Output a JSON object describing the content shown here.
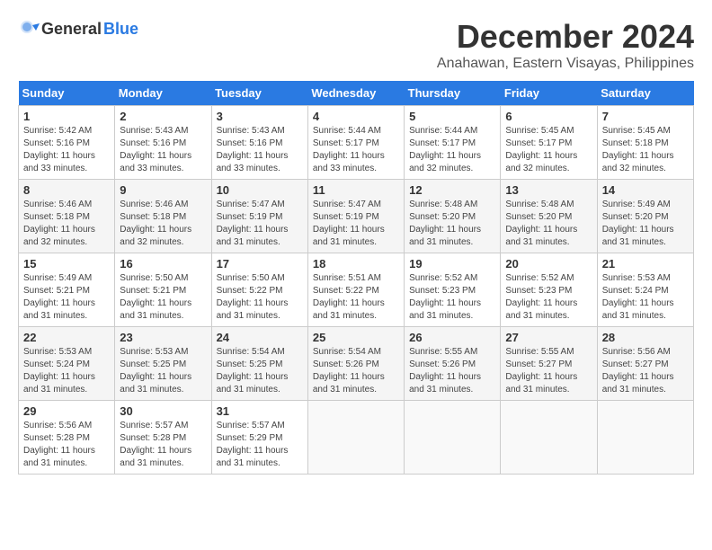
{
  "logo": {
    "general": "General",
    "blue": "Blue"
  },
  "title": "December 2024",
  "location": "Anahawan, Eastern Visayas, Philippines",
  "days_header": [
    "Sunday",
    "Monday",
    "Tuesday",
    "Wednesday",
    "Thursday",
    "Friday",
    "Saturday"
  ],
  "weeks": [
    [
      {
        "day": "1",
        "sunrise": "5:42 AM",
        "sunset": "5:16 PM",
        "daylight": "11 hours and 33 minutes."
      },
      {
        "day": "2",
        "sunrise": "5:43 AM",
        "sunset": "5:16 PM",
        "daylight": "11 hours and 33 minutes."
      },
      {
        "day": "3",
        "sunrise": "5:43 AM",
        "sunset": "5:16 PM",
        "daylight": "11 hours and 33 minutes."
      },
      {
        "day": "4",
        "sunrise": "5:44 AM",
        "sunset": "5:17 PM",
        "daylight": "11 hours and 33 minutes."
      },
      {
        "day": "5",
        "sunrise": "5:44 AM",
        "sunset": "5:17 PM",
        "daylight": "11 hours and 32 minutes."
      },
      {
        "day": "6",
        "sunrise": "5:45 AM",
        "sunset": "5:17 PM",
        "daylight": "11 hours and 32 minutes."
      },
      {
        "day": "7",
        "sunrise": "5:45 AM",
        "sunset": "5:18 PM",
        "daylight": "11 hours and 32 minutes."
      }
    ],
    [
      {
        "day": "8",
        "sunrise": "5:46 AM",
        "sunset": "5:18 PM",
        "daylight": "11 hours and 32 minutes."
      },
      {
        "day": "9",
        "sunrise": "5:46 AM",
        "sunset": "5:18 PM",
        "daylight": "11 hours and 32 minutes."
      },
      {
        "day": "10",
        "sunrise": "5:47 AM",
        "sunset": "5:19 PM",
        "daylight": "11 hours and 31 minutes."
      },
      {
        "day": "11",
        "sunrise": "5:47 AM",
        "sunset": "5:19 PM",
        "daylight": "11 hours and 31 minutes."
      },
      {
        "day": "12",
        "sunrise": "5:48 AM",
        "sunset": "5:20 PM",
        "daylight": "11 hours and 31 minutes."
      },
      {
        "day": "13",
        "sunrise": "5:48 AM",
        "sunset": "5:20 PM",
        "daylight": "11 hours and 31 minutes."
      },
      {
        "day": "14",
        "sunrise": "5:49 AM",
        "sunset": "5:20 PM",
        "daylight": "11 hours and 31 minutes."
      }
    ],
    [
      {
        "day": "15",
        "sunrise": "5:49 AM",
        "sunset": "5:21 PM",
        "daylight": "11 hours and 31 minutes."
      },
      {
        "day": "16",
        "sunrise": "5:50 AM",
        "sunset": "5:21 PM",
        "daylight": "11 hours and 31 minutes."
      },
      {
        "day": "17",
        "sunrise": "5:50 AM",
        "sunset": "5:22 PM",
        "daylight": "11 hours and 31 minutes."
      },
      {
        "day": "18",
        "sunrise": "5:51 AM",
        "sunset": "5:22 PM",
        "daylight": "11 hours and 31 minutes."
      },
      {
        "day": "19",
        "sunrise": "5:52 AM",
        "sunset": "5:23 PM",
        "daylight": "11 hours and 31 minutes."
      },
      {
        "day": "20",
        "sunrise": "5:52 AM",
        "sunset": "5:23 PM",
        "daylight": "11 hours and 31 minutes."
      },
      {
        "day": "21",
        "sunrise": "5:53 AM",
        "sunset": "5:24 PM",
        "daylight": "11 hours and 31 minutes."
      }
    ],
    [
      {
        "day": "22",
        "sunrise": "5:53 AM",
        "sunset": "5:24 PM",
        "daylight": "11 hours and 31 minutes."
      },
      {
        "day": "23",
        "sunrise": "5:53 AM",
        "sunset": "5:25 PM",
        "daylight": "11 hours and 31 minutes."
      },
      {
        "day": "24",
        "sunrise": "5:54 AM",
        "sunset": "5:25 PM",
        "daylight": "11 hours and 31 minutes."
      },
      {
        "day": "25",
        "sunrise": "5:54 AM",
        "sunset": "5:26 PM",
        "daylight": "11 hours and 31 minutes."
      },
      {
        "day": "26",
        "sunrise": "5:55 AM",
        "sunset": "5:26 PM",
        "daylight": "11 hours and 31 minutes."
      },
      {
        "day": "27",
        "sunrise": "5:55 AM",
        "sunset": "5:27 PM",
        "daylight": "11 hours and 31 minutes."
      },
      {
        "day": "28",
        "sunrise": "5:56 AM",
        "sunset": "5:27 PM",
        "daylight": "11 hours and 31 minutes."
      }
    ],
    [
      {
        "day": "29",
        "sunrise": "5:56 AM",
        "sunset": "5:28 PM",
        "daylight": "11 hours and 31 minutes."
      },
      {
        "day": "30",
        "sunrise": "5:57 AM",
        "sunset": "5:28 PM",
        "daylight": "11 hours and 31 minutes."
      },
      {
        "day": "31",
        "sunrise": "5:57 AM",
        "sunset": "5:29 PM",
        "daylight": "11 hours and 31 minutes."
      },
      null,
      null,
      null,
      null
    ]
  ]
}
